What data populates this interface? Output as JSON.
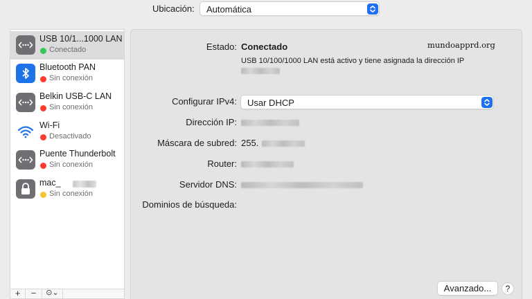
{
  "location": {
    "label": "Ubicación:",
    "value": "Automática"
  },
  "sidebar": {
    "items": [
      {
        "name": "USB 10/1...1000 LAN",
        "status": "Conectado",
        "icon": "ethernet-icon",
        "status_color": "#34c759"
      },
      {
        "name": "Bluetooth PAN",
        "status": "Sin conexión",
        "icon": "bluetooth-icon",
        "status_color": "#ff3b30"
      },
      {
        "name": "Belkin USB-C LAN",
        "status": "Sin conexión",
        "icon": "ethernet-icon",
        "status_color": "#ff3b30"
      },
      {
        "name": "Wi-Fi",
        "status": "Desactivado",
        "icon": "wifi-icon",
        "status_color": "#ff3b30"
      },
      {
        "name": "Puente Thunderbolt",
        "status": "Sin conexión",
        "icon": "ethernet-icon",
        "status_color": "#ff3b30"
      },
      {
        "name": "mac_",
        "status": "Sin conexión",
        "icon": "lock-icon",
        "status_color": "#f5c431"
      }
    ],
    "toolbar": {
      "add": "+",
      "remove": "−",
      "action": "⊙⌄"
    }
  },
  "detail": {
    "status_label": "Estado:",
    "status_value": "Conectado",
    "status_desc": "USB 10/100/1000 LAN está activo y tiene asignada la dirección IP",
    "configure_label": "Configurar IPv4:",
    "configure_value": "Usar DHCP",
    "ip_label": "Dirección IP:",
    "mask_label": "Máscara de subred:",
    "mask_prefix": "255.",
    "router_label": "Router:",
    "dns_label": "Servidor DNS:",
    "search_domains_label": "Dominios de búsqueda:",
    "advanced_button": "Avanzado...",
    "help_button": "?"
  },
  "watermark": "mundoapprd.org",
  "colors": {
    "accent": "#1e6ff1",
    "selection": "#dcdcdc",
    "panel_bg": "#e4e4e4"
  }
}
